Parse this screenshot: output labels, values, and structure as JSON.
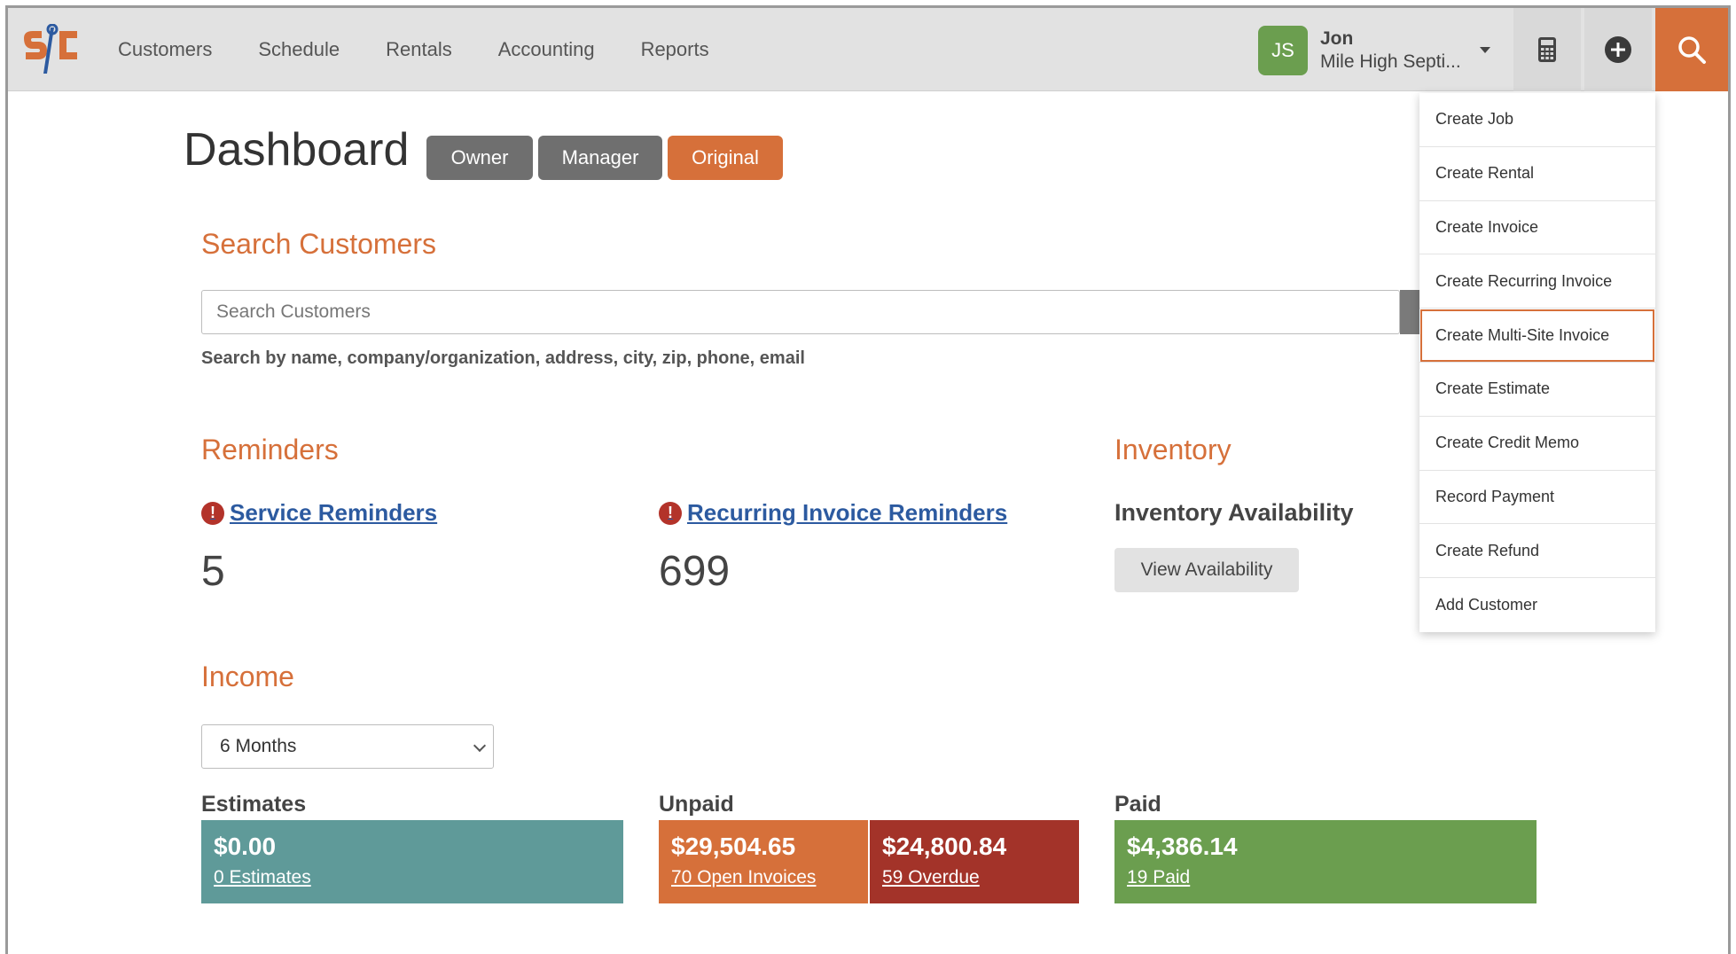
{
  "nav": {
    "items": [
      "Customers",
      "Schedule",
      "Rentals",
      "Accounting",
      "Reports"
    ]
  },
  "user": {
    "initials": "JS",
    "name": "Jon",
    "org": "Mile High Septi..."
  },
  "icons": {
    "calculator": "calculator-icon",
    "plus": "plus-circle-icon",
    "search": "search-icon"
  },
  "colors": {
    "accent": "#d6703a",
    "estimates": "#5f9a99",
    "open": "#d6703a",
    "overdue": "#a33329",
    "paid": "#6b9e4f",
    "link": "#2c5aa0"
  },
  "page": {
    "title": "Dashboard",
    "views": [
      "Owner",
      "Manager",
      "Original"
    ],
    "active_view": "Original"
  },
  "search": {
    "title": "Search Customers",
    "placeholder": "Search Customers",
    "help": "Search by name, company/organization, address, city, zip, phone, email"
  },
  "reminders": {
    "title": "Reminders",
    "service": {
      "label": "Service Reminders",
      "count": "5"
    },
    "recurring": {
      "label": "Recurring Invoice Reminders",
      "count": "699"
    }
  },
  "inventory": {
    "title": "Inventory",
    "subtitle": "Inventory Availability",
    "button": "View Availability"
  },
  "income": {
    "title": "Income",
    "period": "6 Months",
    "estimates": {
      "label": "Estimates",
      "amount": "$0.00",
      "link": "0 Estimates"
    },
    "unpaid": {
      "label": "Unpaid",
      "open": {
        "amount": "$29,504.65",
        "link": "70 Open Invoices"
      },
      "overdue": {
        "amount": "$24,800.84",
        "link": "59 Overdue"
      }
    },
    "paid": {
      "label": "Paid",
      "amount": "$4,386.14",
      "link": "19 Paid"
    }
  },
  "create_menu": {
    "items": [
      "Create Job",
      "Create Rental",
      "Create Invoice",
      "Create Recurring Invoice",
      "Create Multi-Site Invoice",
      "Create Estimate",
      "Create Credit Memo",
      "Record Payment",
      "Create Refund",
      "Add Customer"
    ],
    "highlighted": "Create Multi-Site Invoice"
  }
}
